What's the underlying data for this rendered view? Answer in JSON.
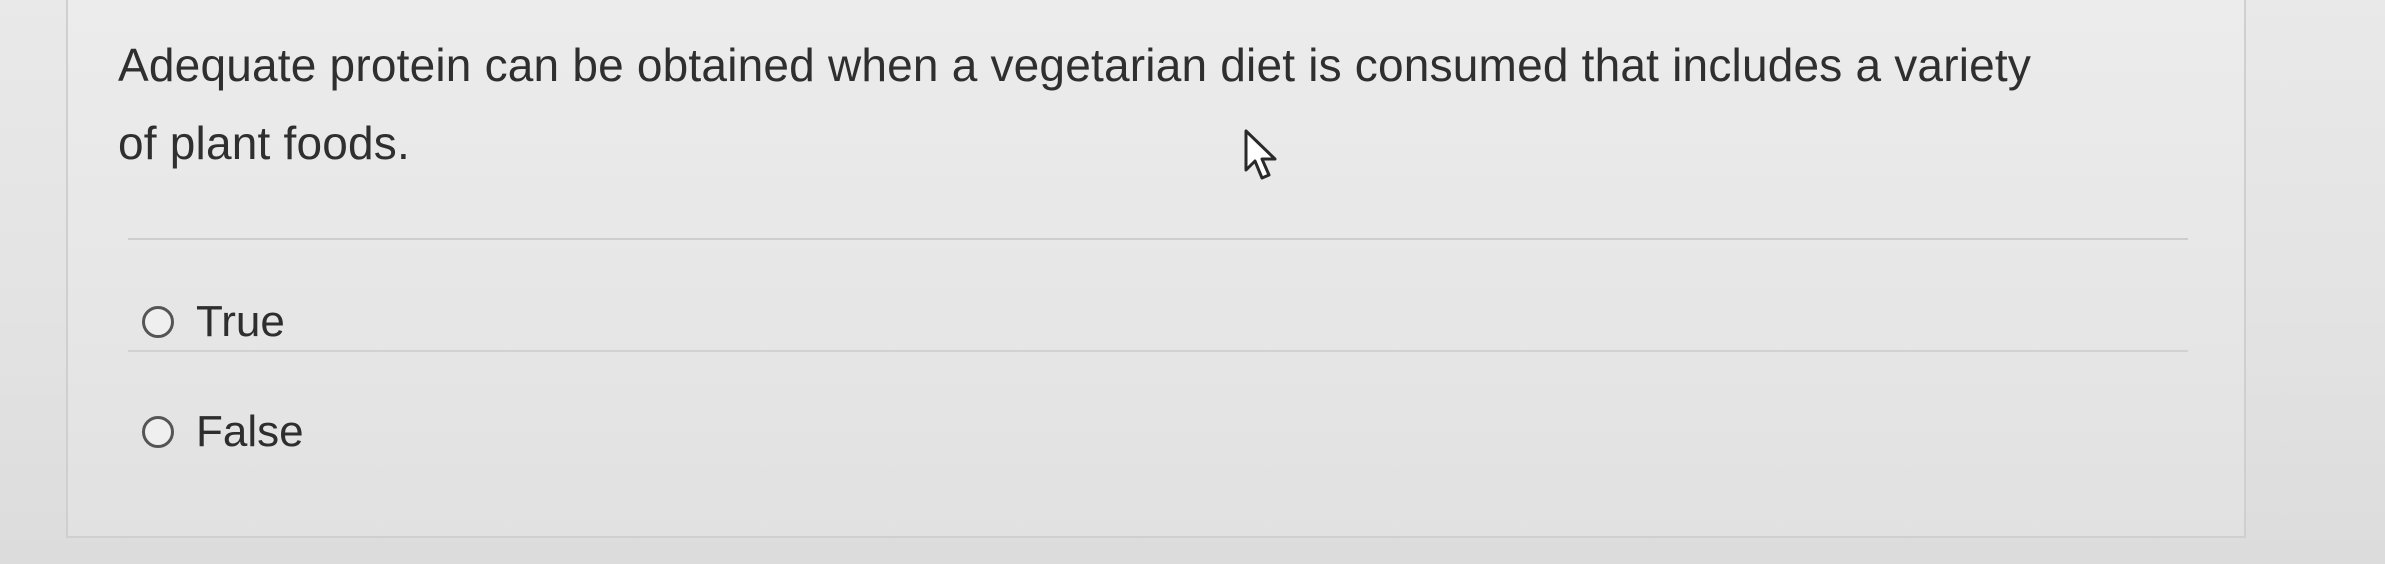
{
  "question": {
    "line1": "Adequate protein can be obtained when a vegetarian diet is consumed that includes a variety",
    "line2": "of plant foods."
  },
  "options": [
    {
      "label": "True",
      "selected": false
    },
    {
      "label": "False",
      "selected": false
    }
  ],
  "cursor": {
    "icon": "pointer-arrow-icon"
  },
  "colors": {
    "text": "#2f2f2f",
    "background": "#e6e6e6",
    "divider": "#cdcdcd",
    "radio_border": "#555555"
  }
}
